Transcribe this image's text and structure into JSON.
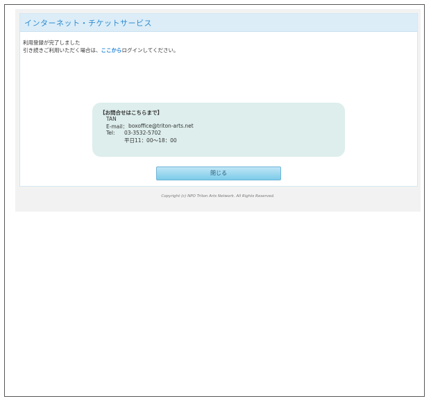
{
  "header": {
    "title": "インターネット・チケットサービス"
  },
  "message": {
    "line1": "利用登録が完了しました",
    "line2_prefix": "引き続きご利用いただく場合は、",
    "line2_link": "ここから",
    "line2_suffix": "ログインしてください。"
  },
  "contact": {
    "heading": "【お問合せはこちらまで】",
    "name": "TAN",
    "email_label": "E-mail：",
    "email": "boxoffice@triton-arts.net",
    "tel_label": "Tel:",
    "tel": "03-3532-5702",
    "hours": "平日11：00〜18：00"
  },
  "buttons": {
    "close_label": "閉じる"
  },
  "footer": {
    "copyright": "Copyright (c) NPO Triton Arts Network. All Rights Reserved."
  },
  "colors": {
    "accent": "#2e8ccf",
    "header_bg": "#dcedf8",
    "contact_bg": "#ddeeec",
    "link": "#1f83d6"
  }
}
